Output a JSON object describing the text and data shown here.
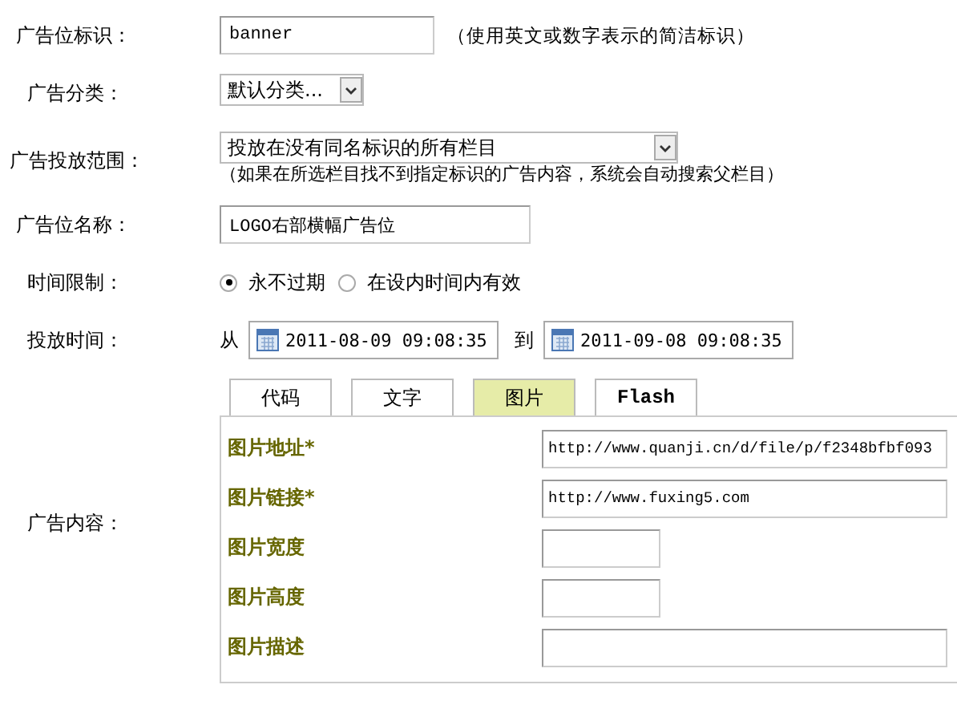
{
  "rows": [
    {
      "kind": "text",
      "label": "广告位标识：",
      "value": "banner",
      "hint": "（使用英文或数字表示的简洁标识）"
    },
    {
      "kind": "select",
      "label": "广告分类：",
      "value": "默认分类..."
    },
    {
      "kind": "select",
      "label": "广告投放范围：",
      "value": "投放在没有同名标识的所有栏目",
      "hint": "（如果在所选栏目找不到指定标识的广告内容，系统会自动搜索父栏目）"
    },
    {
      "kind": "text",
      "label": "广告位名称：",
      "value": "LOGO右部横幅广告位"
    },
    {
      "kind": "radio",
      "label": "时间限制：",
      "options": [
        {
          "label": "永不过期",
          "selected": true
        },
        {
          "label": "在设内时间内有效",
          "selected": false
        }
      ]
    },
    {
      "kind": "daterange",
      "label": "投放时间：",
      "from_label": "从",
      "from": "2011-08-09 09:08:35",
      "to_label": "到",
      "to": "2011-09-08 09:08:35"
    }
  ],
  "content": {
    "label": "广告内容：",
    "tabs": [
      {
        "label": "代码",
        "selected": false
      },
      {
        "label": "文字",
        "selected": false
      },
      {
        "label": "图片",
        "selected": true
      },
      {
        "label": "Flash",
        "selected": false
      }
    ],
    "fields": [
      {
        "label": "图片地址*",
        "value": "http://www.quanji.cn/d/file/p/f2348bfbf093"
      },
      {
        "label": "图片链接*",
        "value": "http://www.fuxing5.com"
      },
      {
        "label": "图片宽度"
      },
      {
        "label": "图片高度"
      },
      {
        "label": "图片描述"
      }
    ]
  }
}
